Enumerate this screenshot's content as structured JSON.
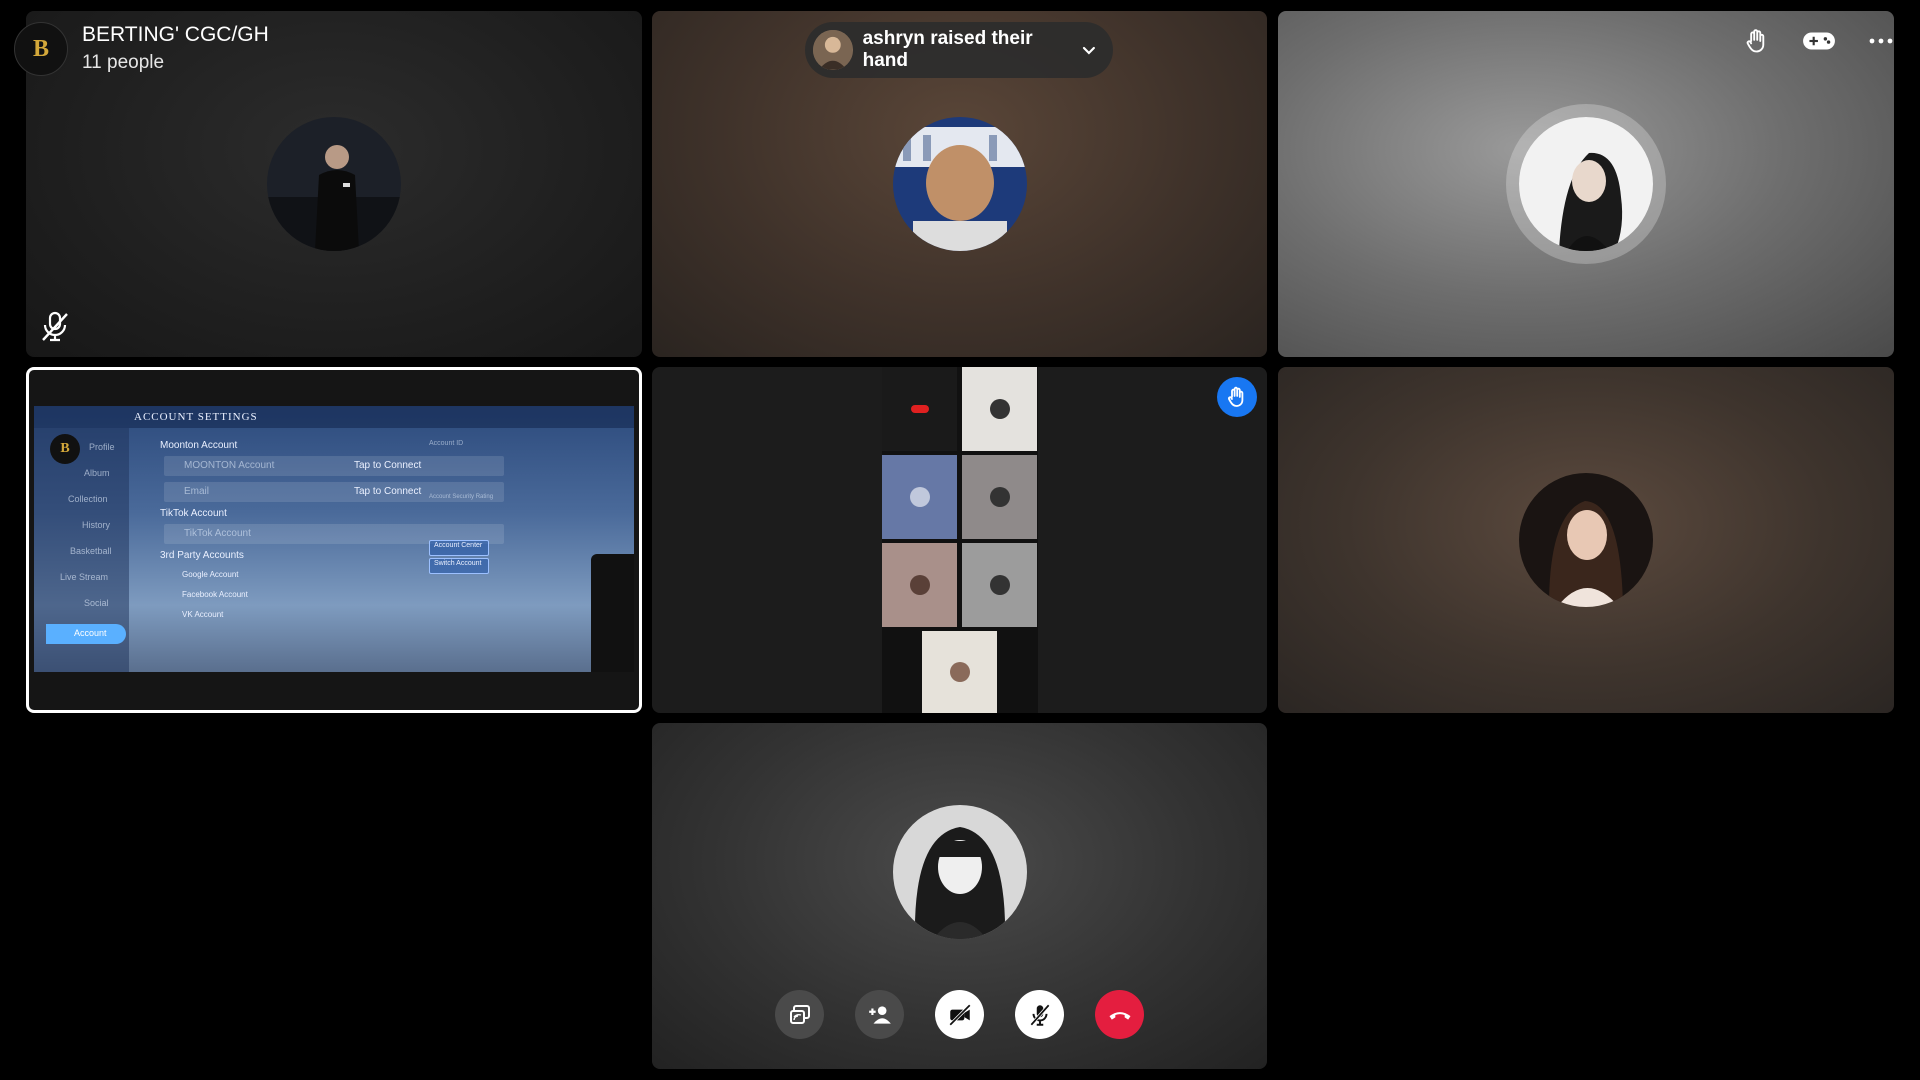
{
  "header": {
    "logo_text": "B",
    "title": "BERTING' CGC/GH",
    "people_count": "11 people"
  },
  "notification": {
    "text": "ashryn raised their hand"
  },
  "top_icons": [
    "raise-hand-icon",
    "gamepad-icon",
    "more-options-icon"
  ],
  "screenshare": {
    "title": "ACCOUNT SETTINGS",
    "moonton_account": "Moonton Account",
    "moonton_account_row": "MOONTON Account",
    "email_row": "Email",
    "tap_to_connect": "Tap to Connect",
    "tiktok_account": "TikTok Account",
    "tiktok_row": "TikTok Account",
    "third_party": "3rd Party Accounts",
    "google_row": "Google Account",
    "facebook_row": "Facebook Account",
    "vk_row": "VK Account",
    "account_security_rating": "Account Security Rating",
    "account_center": "Account Center",
    "switch_account": "Switch Account",
    "account_id": "Account ID",
    "profile": "Profile",
    "album": "Album",
    "collection": "Collection",
    "history": "History",
    "basketball": "Basketball",
    "live_stream": "Live Stream",
    "social": "Social",
    "account": "Account"
  },
  "controls": [
    {
      "name": "share-screen-button",
      "icon": "share-screen-icon",
      "style": "dark"
    },
    {
      "name": "add-people-button",
      "icon": "add-person-icon",
      "style": "dark"
    },
    {
      "name": "camera-toggle-button",
      "icon": "camera-off-icon",
      "style": "light"
    },
    {
      "name": "mic-toggle-button",
      "icon": "mic-off-icon",
      "style": "light"
    },
    {
      "name": "end-call-button",
      "icon": "end-call-icon",
      "style": "red"
    }
  ],
  "colors": {
    "background": "#000000",
    "end_call_red": "#e41e3f",
    "raise_hand_blue": "#1877f2",
    "logo_gold": "#d4a83a"
  }
}
